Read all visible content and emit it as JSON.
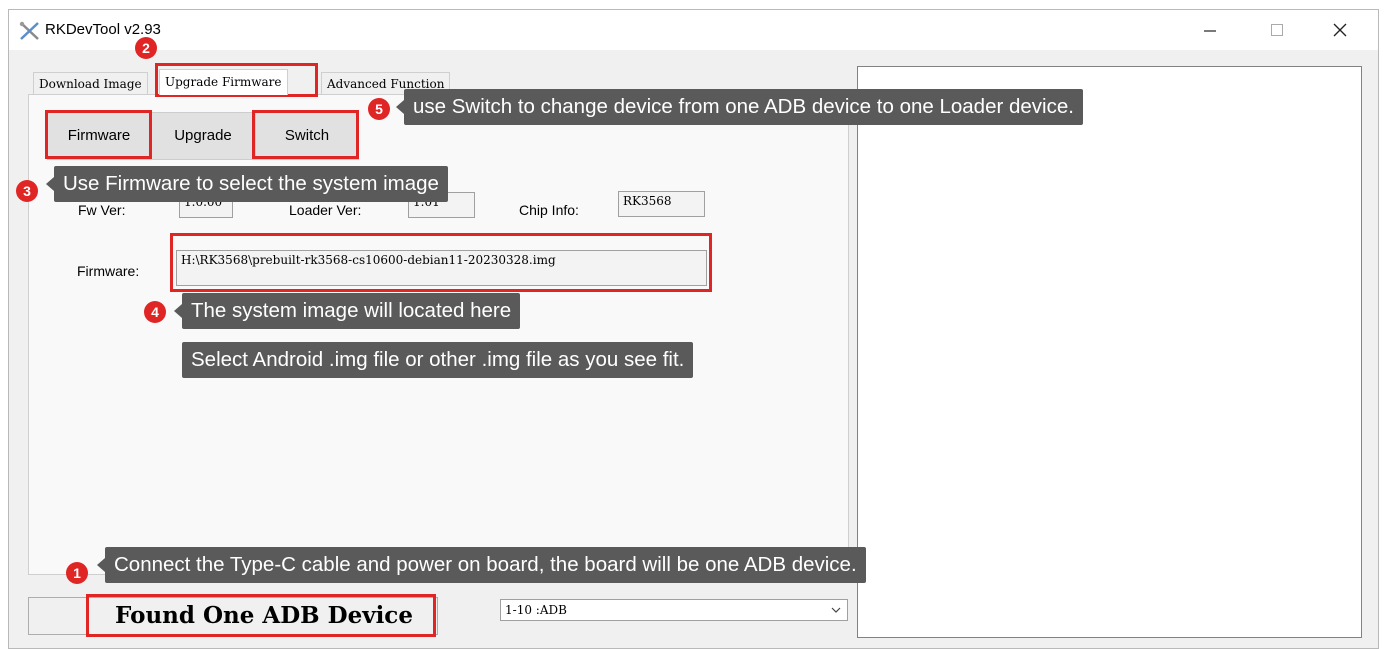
{
  "window": {
    "title": "RKDevTool v2.93",
    "controls": {
      "minimize_icon": "minimize-icon",
      "maximize_icon": "maximize-icon",
      "close_icon": "close-icon"
    }
  },
  "tabs": [
    {
      "label": "Download Image",
      "active": false
    },
    {
      "label": "Upgrade Firmware",
      "active": true
    },
    {
      "label": "Advanced Function",
      "active": false
    }
  ],
  "upgrade_panel": {
    "buttons": {
      "firmware": "Firmware",
      "upgrade": "Upgrade",
      "switch": "Switch"
    },
    "fw_ver_label": "Fw Ver:",
    "fw_ver_value": "1.0.00",
    "loader_ver_label": "Loader Ver:",
    "loader_ver_value": "1.01",
    "chip_info_label": "Chip Info:",
    "chip_info_value": "RK3568",
    "firmware_label": "Firmware:",
    "firmware_path": "H:\\RK3568\\prebuilt-rk3568-cs10600-debian11-20230328.img"
  },
  "status": {
    "message": "Found One ADB Device",
    "device_select_value": "1-10 :ADB"
  },
  "annotations": [
    {
      "badge": "1",
      "text": "Connect the Type-C cable and power on board, the board will be one ADB device."
    },
    {
      "badge": "2"
    },
    {
      "badge": "3",
      "text": "Use Firmware to select the system image"
    },
    {
      "badge": "4",
      "text": "The system image will located here",
      "text2": "Select Android .img file or other .img file as you see fit."
    },
    {
      "badge": "5",
      "text": "use Switch to change device from one ADB device to one Loader device."
    }
  ],
  "colors": {
    "highlight": "#e02525",
    "callout_bg": "#5a5a5a"
  }
}
